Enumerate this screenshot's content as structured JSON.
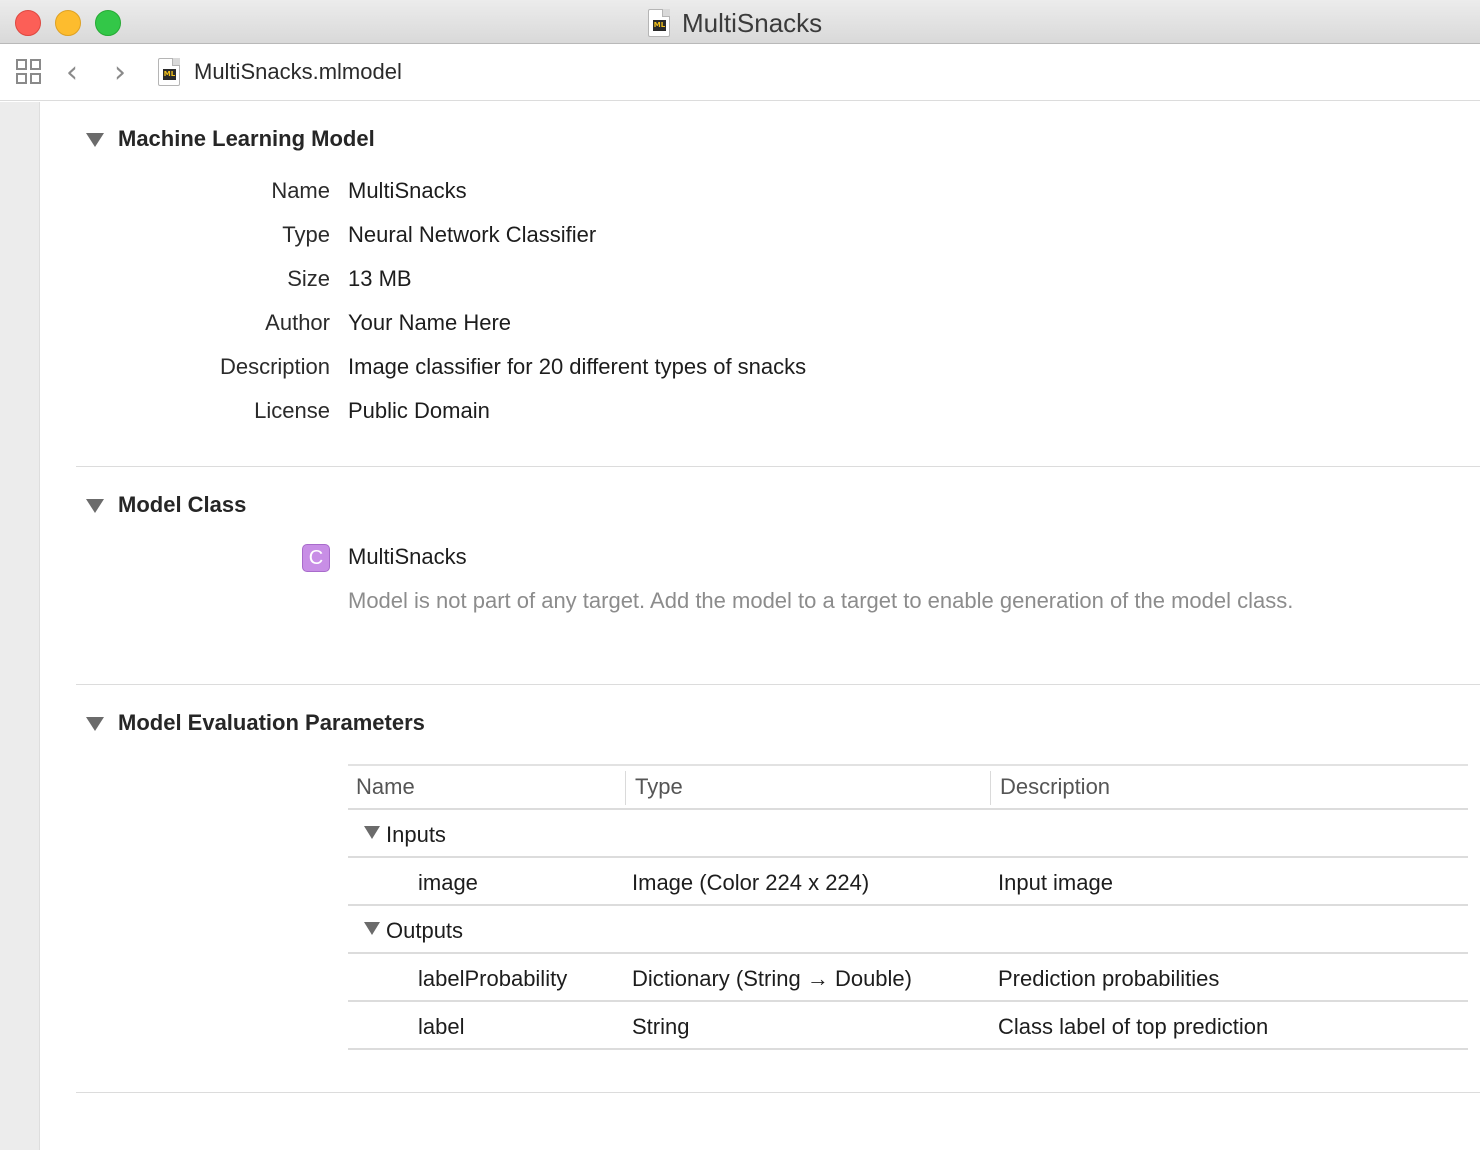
{
  "window": {
    "title": "MultiSnacks",
    "file_icon_badge": "ML"
  },
  "jumpbar": {
    "file_name": "MultiSnacks.mlmodel",
    "file_icon_badge": "ML"
  },
  "sections": {
    "model": {
      "title": "Machine Learning Model",
      "rows": [
        {
          "key": "Name",
          "value": "MultiSnacks"
        },
        {
          "key": "Type",
          "value": "Neural Network Classifier"
        },
        {
          "key": "Size",
          "value": "13 MB"
        },
        {
          "key": "Author",
          "value": "Your Name Here"
        },
        {
          "key": "Description",
          "value": "Image classifier for 20 different types of snacks"
        },
        {
          "key": "License",
          "value": "Public Domain"
        }
      ]
    },
    "model_class": {
      "title": "Model Class",
      "badge": "C",
      "class_name": "MultiSnacks",
      "note": "Model is not part of any target. Add the model to a target to enable generation of the model class."
    },
    "evaluation": {
      "title": "Model Evaluation Parameters",
      "columns": [
        "Name",
        "Type",
        "Description"
      ],
      "groups": [
        {
          "label": "Inputs",
          "rows": [
            {
              "name": "image",
              "type": "Image (Color 224 x 224)",
              "description": "Input image"
            }
          ]
        },
        {
          "label": "Outputs",
          "rows": [
            {
              "name": "labelProbability",
              "type": "Dictionary (String → Double)",
              "description": "Prediction probabilities"
            },
            {
              "name": "label",
              "type": "String",
              "description": "Class label of top prediction"
            }
          ]
        }
      ]
    }
  },
  "colors": {
    "close": "#fc5f57",
    "minimize": "#fdbc2e",
    "maximize": "#33c748",
    "class_badge": "#c88ee6"
  }
}
